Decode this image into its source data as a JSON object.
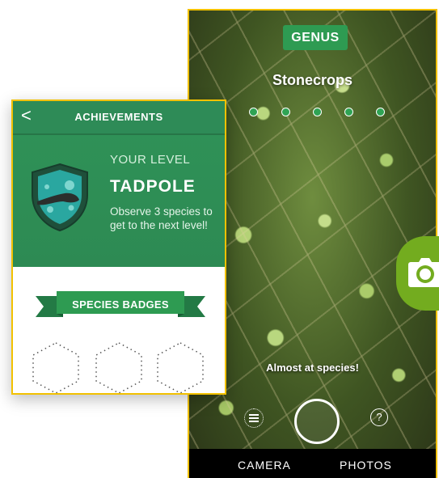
{
  "camera": {
    "rank_badge": "GENUS",
    "taxon_name": "Stonecrops",
    "rank_dots": 5,
    "hint": "Almost at species!",
    "bottom_tabs": [
      "CAMERA",
      "PHOTOS"
    ],
    "icons": [
      "filter-icon",
      "shutter-icon",
      "help-icon",
      "camera-icon"
    ],
    "colors": {
      "accent": "#2e9b52",
      "floating_button": "#73ac1f",
      "frame_highlight": "#f2c100"
    }
  },
  "achievements": {
    "back_label": "<",
    "title": "ACHIEVEMENTS",
    "level": {
      "label": "YOUR LEVEL",
      "name": "TADPOLE",
      "description": "Observe 3 species to get to the next level!"
    },
    "species_badges": {
      "title": "SPECIES BADGES",
      "slots": 3
    },
    "colors": {
      "header": "#2e8b57",
      "banner": "#2e9b52"
    }
  },
  "help_label": "?"
}
